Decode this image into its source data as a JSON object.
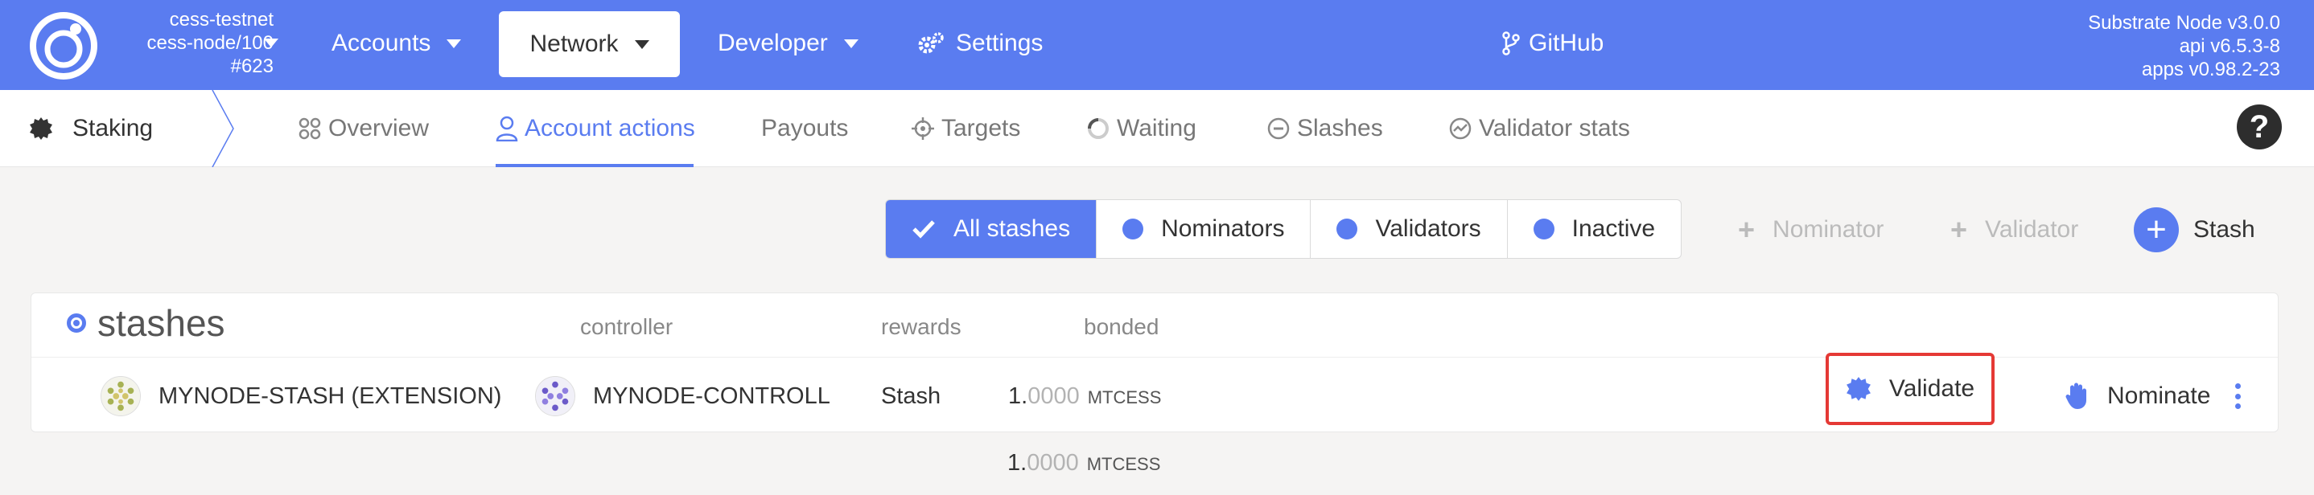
{
  "brand": {
    "accent": "#5a7cf0",
    "highlight": "#e53935"
  },
  "chain": {
    "name": "cess-testnet",
    "node": "cess-node/100",
    "block": "#623"
  },
  "topnav": {
    "accounts": "Accounts",
    "network": "Network",
    "developer": "Developer",
    "settings": "Settings",
    "github": "GitHub"
  },
  "version": {
    "node": "Substrate Node v3.0.0",
    "api": "api v6.5.3-8",
    "apps": "apps v0.98.2-23"
  },
  "subnav": {
    "section": "Staking",
    "tabs": [
      {
        "label": "Overview",
        "icon": "grid-icon"
      },
      {
        "label": "Account actions",
        "icon": "user-icon",
        "active": true
      },
      {
        "label": "Payouts",
        "icon": ""
      },
      {
        "label": "Targets",
        "icon": "target-icon"
      },
      {
        "label": "Waiting",
        "icon": "spinner-icon"
      },
      {
        "label": "Slashes",
        "icon": "minus-circle-icon"
      },
      {
        "label": "Validator stats",
        "icon": "chart-icon"
      }
    ],
    "help": "?"
  },
  "filters": {
    "all": "All stashes",
    "nominators": "Nominators",
    "validators": "Validators",
    "inactive": "Inactive"
  },
  "actions": {
    "nominator": "Nominator",
    "validator": "Validator",
    "stash": "Stash"
  },
  "table": {
    "title": "stashes",
    "headers": {
      "controller": "controller",
      "rewards": "rewards",
      "bonded": "bonded"
    },
    "rows": [
      {
        "stash": "MYNODE-STASH (EXTENSION)",
        "controller": "MYNODE-CONTROLL",
        "rewards": "Stash",
        "bonded_int": "1.",
        "bonded_frac": "0000",
        "unit": "MTCESS",
        "validate": "Validate",
        "nominate": "Nominate"
      }
    ],
    "total": {
      "int": "1.",
      "frac": "0000",
      "unit": "MTCESS"
    }
  }
}
